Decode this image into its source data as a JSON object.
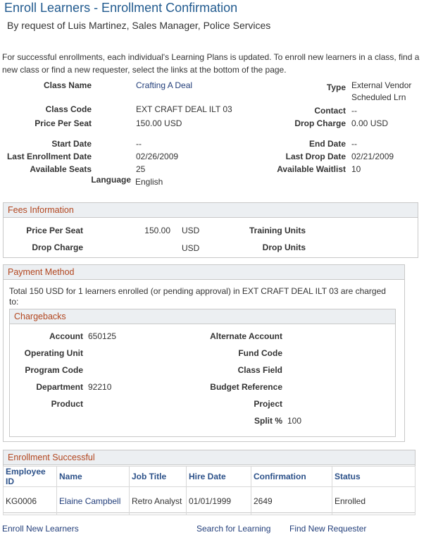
{
  "page": {
    "title": "Enroll Learners - Enrollment Confirmation",
    "subtitle": "By request of Luis Martinez, Sales Manager, Police Services",
    "intro": "For successful enrollments, each individual's Learning Plans is updated. To enroll new learners in a class, find a new class or find a new requester, select the links at the bottom of the page."
  },
  "cls": {
    "class_name_label": "Class Name",
    "class_name": "Crafting A Deal",
    "type_label": "Type",
    "type_line1": "External Vendor",
    "type_line2": "Scheduled Lrn",
    "class_code_label": "Class Code",
    "class_code": "EXT CRAFT DEAL ILT 03",
    "contact_label": "Contact",
    "contact": "--",
    "price_label": "Price Per Seat",
    "price": "150.00 USD",
    "drop_charge_label": "Drop Charge",
    "drop_charge": "0.00 USD",
    "start_date_label": "Start Date",
    "start_date": "--",
    "end_date_label": "End Date",
    "end_date": "--",
    "last_enroll_label": "Last Enrollment Date",
    "last_enroll": "02/26/2009",
    "last_drop_label": "Last Drop Date",
    "last_drop": "02/21/2009",
    "avail_seats_label": "Available Seats",
    "avail_seats": "25",
    "avail_wait_label": "Available Waitlist",
    "avail_wait": "10",
    "language_label": "Language",
    "language": "English"
  },
  "fees": {
    "header": "Fees Information",
    "price_label": "Price Per Seat",
    "price": "150.00",
    "price_cur": "USD",
    "drop_label": "Drop Charge",
    "drop_cur": "USD",
    "training_units_label": "Training Units",
    "drop_units_label": "Drop Units"
  },
  "payment": {
    "header": "Payment Method",
    "text": "Total 150 USD for 1 learners enrolled (or pending approval) in EXT CRAFT DEAL ILT 03 are charged to:"
  },
  "chargebacks": {
    "header": "Chargebacks",
    "account_label": "Account",
    "account": "650125",
    "alt_account_label": "Alternate Account",
    "op_unit_label": "Operating Unit",
    "fund_code_label": "Fund Code",
    "program_label": "Program Code",
    "class_field_label": "Class Field",
    "dept_label": "Department",
    "dept": "92210",
    "budget_label": "Budget Reference",
    "product_label": "Product",
    "project_label": "Project",
    "split_label": "Split %",
    "split": "100"
  },
  "enrollment": {
    "header": "Enrollment Successful",
    "columns": [
      "Employee ID",
      "Name",
      "Job Title",
      "Hire Date",
      "Confirmation",
      "Status"
    ],
    "rows": [
      {
        "employee_id": "KG0006",
        "name": "Elaine Campbell",
        "job_title": "Retro Analyst",
        "hire_date": "01/01/1999",
        "confirmation": "2649",
        "status": "Enrolled"
      }
    ]
  },
  "links": {
    "enroll_new": "Enroll New Learners",
    "search": "Search for Learning",
    "find_requester": "Find New Requester"
  }
}
